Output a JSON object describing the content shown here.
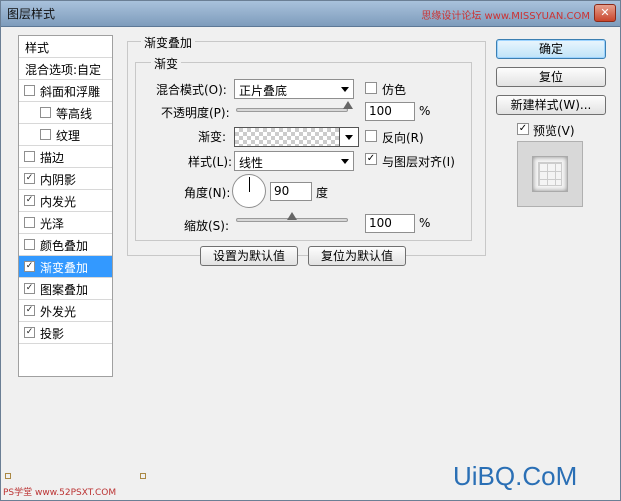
{
  "window": {
    "title": "图层样式",
    "watermark_top": "思缘设计论坛 www.MISSYUAN.COM",
    "close_label": "✕"
  },
  "sidebar": {
    "items": [
      {
        "label": "样式",
        "type": "plain",
        "checked": false
      },
      {
        "label": "混合选项:自定",
        "type": "plain",
        "checked": false
      },
      {
        "label": "斜面和浮雕",
        "type": "check",
        "checked": false
      },
      {
        "label": "等高线",
        "type": "indent",
        "checked": false
      },
      {
        "label": "纹理",
        "type": "indent",
        "checked": false
      },
      {
        "label": "描边",
        "type": "check",
        "checked": false
      },
      {
        "label": "内阴影",
        "type": "check",
        "checked": true
      },
      {
        "label": "内发光",
        "type": "check",
        "checked": true
      },
      {
        "label": "光泽",
        "type": "check",
        "checked": false
      },
      {
        "label": "颜色叠加",
        "type": "check",
        "checked": false
      },
      {
        "label": "渐变叠加",
        "type": "check",
        "checked": true,
        "selected": true
      },
      {
        "label": "图案叠加",
        "type": "check",
        "checked": true
      },
      {
        "label": "外发光",
        "type": "check",
        "checked": true
      },
      {
        "label": "投影",
        "type": "check",
        "checked": true
      }
    ]
  },
  "panel": {
    "group_title": "渐变叠加",
    "sub_title": "渐变",
    "blend_mode_label": "混合模式(O):",
    "blend_mode_value": "正片叠底",
    "dither_label": "仿色",
    "dither_checked": false,
    "opacity_label": "不透明度(P):",
    "opacity_value": "100",
    "opacity_fraction": 1.0,
    "unit_percent": "%",
    "gradient_label": "渐变:",
    "reverse_label": "反向(R)",
    "reverse_checked": false,
    "style_label": "样式(L):",
    "style_value": "线性",
    "align_label": "与图层对齐(I)",
    "align_checked": true,
    "angle_label": "角度(N):",
    "angle_value": "90",
    "angle_unit": "度",
    "scale_label": "缩放(S):",
    "scale_value": "100",
    "scale_fraction": 0.5,
    "set_default_label": "设置为默认值",
    "reset_default_label": "复位为默认值"
  },
  "actions": {
    "ok_label": "确定",
    "reset_label": "复位",
    "new_style_label": "新建样式(W)...",
    "preview_label": "预览(V)",
    "preview_checked": true
  },
  "watermarks": {
    "bottom_left": "PS学堂 www.52PSXT.COM",
    "bottom_right": "UiBQ.CoM"
  },
  "check_glyph": "✓"
}
